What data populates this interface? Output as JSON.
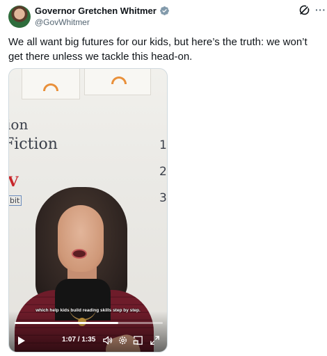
{
  "author": {
    "display_name": "Governor Gretchen Whitmer",
    "handle": "@GovWhitmer",
    "verified_icon": "verified-badge-icon"
  },
  "header_actions": {
    "grok_icon": "grok-icon",
    "more_label": "···"
  },
  "tweet": {
    "text": "We all want big futures for our kids, but here’s the truth: we won’t get there unless we tackle this head-on."
  },
  "video": {
    "caption": "which help kids build reading skills step by step.",
    "time_display": "1:07 / 1:35",
    "progress_fraction": 0.7,
    "icons": [
      "play-icon",
      "volume-icon",
      "settings-icon",
      "pip-icon",
      "fullscreen-icon"
    ],
    "board_text": {
      "line1": "ion",
      "line2": "Fiction",
      "side_letters": "V",
      "small_text": "bit",
      "numbers": [
        "1",
        "2",
        "3"
      ]
    }
  },
  "colors": {
    "text_primary": "#0f1419",
    "text_secondary": "#536471",
    "verified_blue": "#1d9bf0",
    "media_border": "#cfd9de"
  }
}
